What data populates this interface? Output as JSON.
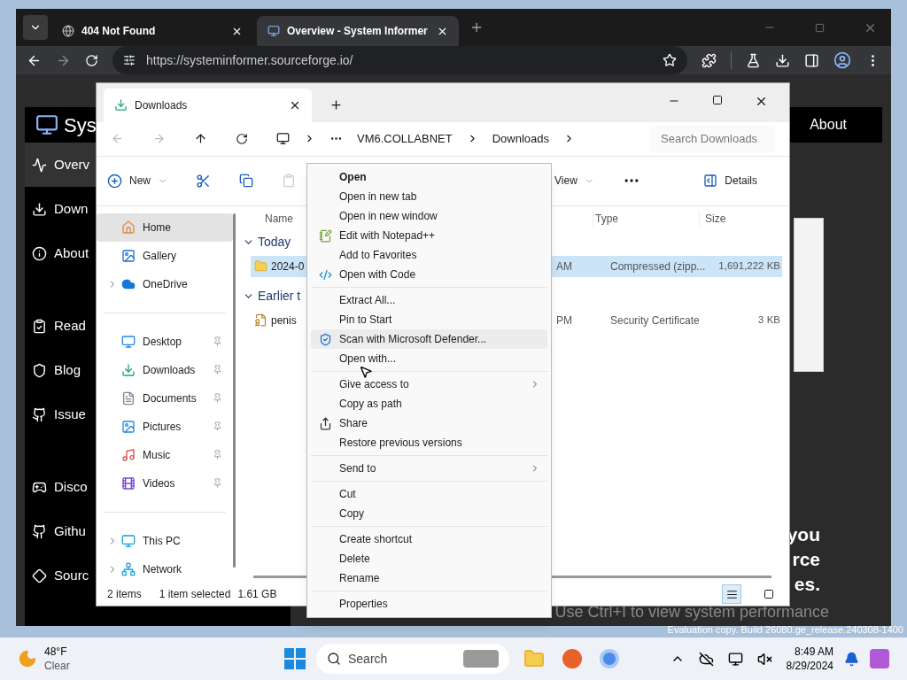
{
  "browser": {
    "tabs": [
      {
        "title": "404 Not Found",
        "selected": false,
        "kind": "globe"
      },
      {
        "title": "Overview - System Informer",
        "selected": true,
        "kind": "site"
      }
    ],
    "url": "https://systeminformer.sourceforge.io/",
    "site": {
      "title": "Sys",
      "header_link": "About",
      "nav_groups": [
        [
          {
            "label": "Overv",
            "selected": true
          },
          {
            "label": "Down",
            "selected": false
          },
          {
            "label": "About",
            "selected": false
          }
        ],
        [
          {
            "label": "Read",
            "selected": false
          },
          {
            "label": "Blog",
            "selected": false
          },
          {
            "label": "Issue",
            "selected": false
          }
        ],
        [
          {
            "label": "Disco",
            "selected": false
          },
          {
            "label": "Githu",
            "selected": false
          },
          {
            "label": "Sourc",
            "selected": false
          }
        ]
      ],
      "hero_lines": [
        "you",
        "rce",
        "es."
      ],
      "hint": "Use Ctrl+I to view system performance"
    }
  },
  "explorer": {
    "tab": "Downloads",
    "breadcrumb": [
      "VM6.COLLABNET",
      "Downloads"
    ],
    "search": {
      "placeholder": "Search Downloads"
    },
    "toolbar": {
      "new": "New",
      "view": "View",
      "details": "Details"
    },
    "nav_groups": [
      [
        {
          "label": "Home",
          "selected": true,
          "expandable": false,
          "pinned": false
        },
        {
          "label": "Gallery",
          "selected": false,
          "expandable": false,
          "pinned": false
        },
        {
          "label": "OneDrive",
          "selected": false,
          "expandable": true,
          "pinned": false
        }
      ],
      [
        {
          "label": "Desktop",
          "selected": false,
          "expandable": false,
          "pinned": true
        },
        {
          "label": "Downloads",
          "selected": false,
          "expandable": false,
          "pinned": true
        },
        {
          "label": "Documents",
          "selected": false,
          "expandable": false,
          "pinned": true
        },
        {
          "label": "Pictures",
          "selected": false,
          "expandable": false,
          "pinned": true
        },
        {
          "label": "Music",
          "selected": false,
          "expandable": false,
          "pinned": true
        },
        {
          "label": "Videos",
          "selected": false,
          "expandable": false,
          "pinned": true
        }
      ],
      [
        {
          "label": "This PC",
          "selected": false,
          "expandable": true,
          "pinned": false
        },
        {
          "label": "Network",
          "selected": false,
          "expandable": true,
          "pinned": false
        }
      ]
    ],
    "columns": [
      "Name",
      "Type",
      "Size"
    ],
    "groups": [
      {
        "title": "Today",
        "expanded": true,
        "files": [
          {
            "name": "2024-0",
            "kind": "zip",
            "date": "AM",
            "type": "Compressed (zipp...",
            "size": "1,691,222 KB",
            "selected": true
          }
        ]
      },
      {
        "title": "Earlier t",
        "expanded": true,
        "files": [
          {
            "name": "penis",
            "kind": "certificate",
            "date": "PM",
            "type": "Security Certificate",
            "size": "3 KB",
            "selected": false
          }
        ]
      }
    ],
    "status": {
      "count": "2 items",
      "selection": "1 item selected",
      "size": "1.61 GB"
    },
    "view_buttons": [
      {
        "kind": "details",
        "selected": true
      },
      {
        "kind": "tiles",
        "selected": false
      }
    ]
  },
  "context_menu": [
    {
      "kind": "item",
      "label": "Open",
      "default": true,
      "hovered": false,
      "submenu": false
    },
    {
      "kind": "item",
      "label": "Open in new tab",
      "default": false,
      "hovered": false,
      "submenu": false
    },
    {
      "kind": "item",
      "label": "Open in new window",
      "default": false,
      "hovered": false,
      "submenu": false
    },
    {
      "kind": "item",
      "label": "Edit with Notepad++",
      "default": false,
      "hovered": false,
      "submenu": false
    },
    {
      "kind": "item",
      "label": "Add to Favorites",
      "default": false,
      "hovered": false,
      "submenu": false
    },
    {
      "kind": "item",
      "label": "Open with Code",
      "default": false,
      "hovered": false,
      "submenu": false
    },
    {
      "kind": "separator"
    },
    {
      "kind": "item",
      "label": "Extract All...",
      "default": false,
      "hovered": false,
      "submenu": false
    },
    {
      "kind": "item",
      "label": "Pin to Start",
      "default": false,
      "hovered": false,
      "submenu": false
    },
    {
      "kind": "item",
      "label": "Scan with Microsoft Defender...",
      "default": false,
      "hovered": true,
      "submenu": false
    },
    {
      "kind": "item",
      "label": "Open with...",
      "default": false,
      "hovered": false,
      "submenu": false
    },
    {
      "kind": "separator"
    },
    {
      "kind": "item",
      "label": "Give access to",
      "default": false,
      "hovered": false,
      "submenu": true
    },
    {
      "kind": "item",
      "label": "Copy as path",
      "default": false,
      "hovered": false,
      "submenu": false
    },
    {
      "kind": "item",
      "label": "Share",
      "default": false,
      "hovered": false,
      "submenu": false
    },
    {
      "kind": "item",
      "label": "Restore previous versions",
      "default": false,
      "hovered": false,
      "submenu": false
    },
    {
      "kind": "separator"
    },
    {
      "kind": "item",
      "label": "Send to",
      "default": false,
      "hovered": false,
      "submenu": true
    },
    {
      "kind": "separator"
    },
    {
      "kind": "item",
      "label": "Cut",
      "default": false,
      "hovered": false,
      "submenu": false
    },
    {
      "kind": "item",
      "label": "Copy",
      "default": false,
      "hovered": false,
      "submenu": false
    },
    {
      "kind": "separator"
    },
    {
      "kind": "item",
      "label": "Create shortcut",
      "default": false,
      "hovered": false,
      "submenu": false
    },
    {
      "kind": "item",
      "label": "Delete",
      "default": false,
      "hovered": false,
      "submenu": false
    },
    {
      "kind": "item",
      "label": "Rename",
      "default": false,
      "hovered": false,
      "submenu": false
    },
    {
      "kind": "separator"
    },
    {
      "kind": "item",
      "label": "Properties",
      "default": false,
      "hovered": false,
      "submenu": false
    }
  ],
  "watermark": "Evaluation copy. Build 26080.ge_release.240308-1400",
  "taskbar": {
    "weather": {
      "temp": "48°F",
      "condition": "Clear"
    },
    "search": "Search",
    "time": "8:49 AM",
    "date": "8/29/2024"
  }
}
